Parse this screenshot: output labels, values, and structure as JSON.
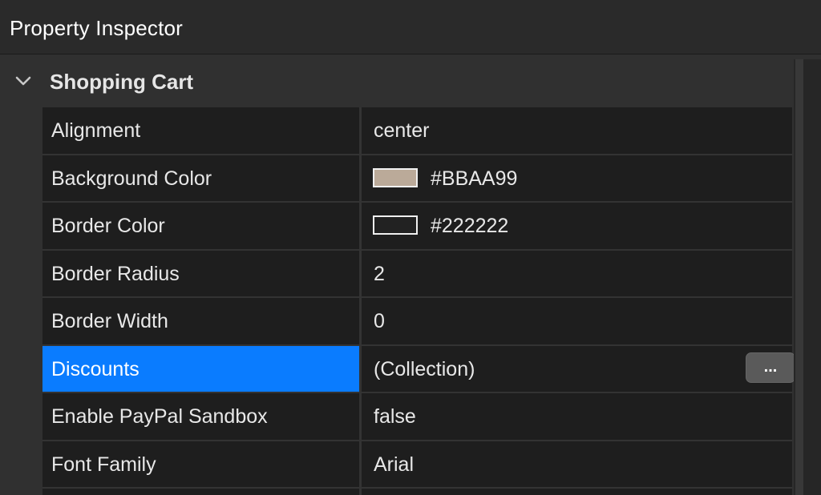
{
  "window": {
    "title": "Property Inspector"
  },
  "group": {
    "title": "Shopping Cart",
    "expanded": true
  },
  "properties": [
    {
      "name": "Alignment",
      "value": "center"
    },
    {
      "name": "Background Color",
      "value": "#BBAA99",
      "swatch": "#BBAA99"
    },
    {
      "name": "Border Color",
      "value": "#222222",
      "swatch": "#222222"
    },
    {
      "name": "Border Radius",
      "value": "2"
    },
    {
      "name": "Border Width",
      "value": "0"
    },
    {
      "name": "Discounts",
      "value": "(Collection)",
      "selected": true
    },
    {
      "name": "Enable PayPal Sandbox",
      "value": "false"
    },
    {
      "name": "Font Family",
      "value": "Arial"
    }
  ],
  "collection_editor": {
    "label": "..."
  },
  "colors": {
    "selection": "#0a7cff",
    "background_swatch": "#BBAA99",
    "border_swatch": "#222222"
  },
  "icons": {
    "group_toggle": "chevron-down-icon"
  }
}
